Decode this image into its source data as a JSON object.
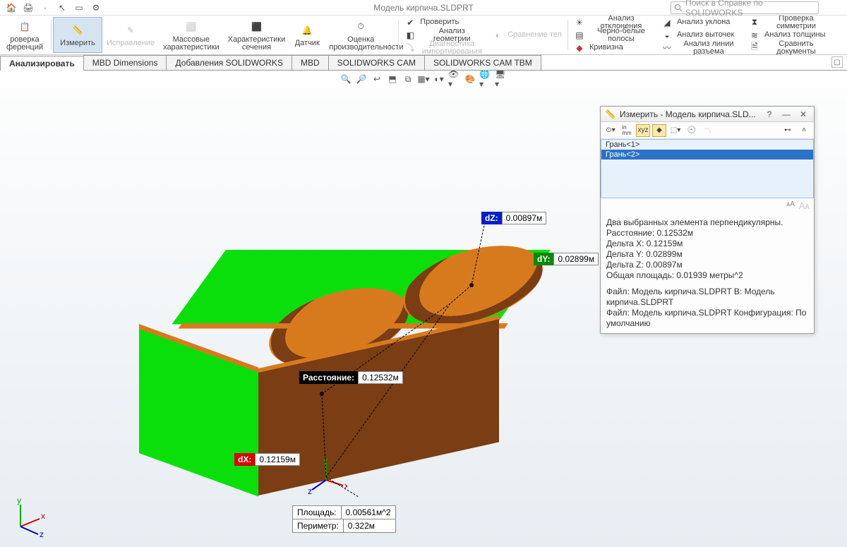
{
  "title": "Модель кирпича.SLDPRT",
  "search_placeholder": "Поиск в Справке по SOLIDWORKS",
  "ribbon": {
    "check_ref": "роверка\nференций",
    "measure": "Измерить",
    "fix": "Исправление",
    "mass": "Массовые\nхарактеристики",
    "section": "Характеристики\nсечения",
    "sensor": "Датчик",
    "perf": "Оценка\nпроизводительности",
    "check": "Проверить",
    "geom": "Анализ геометрии",
    "import": "Диагностика импортирования",
    "compare": "Сравнение тел",
    "dev": "Анализ отклонения",
    "stripes": "Черно-белые полосы",
    "curv": "Кривизна",
    "draft": "Анализ уклона",
    "undercut": "Анализ выточек",
    "parting": "Анализ линии разъема",
    "sym": "Проверка симметрии",
    "thick": "Анализ толщины",
    "diff": "Сравнить документы"
  },
  "tabs": [
    "Анализировать",
    "MBD Dimensions",
    "Добавления SOLIDWORKS",
    "MBD",
    "SOLIDWORKS CAM",
    "SOLIDWORKS CAM TBM"
  ],
  "measure": {
    "dz": {
      "k": "dZ:",
      "v": "0.00897м"
    },
    "dy": {
      "k": "dY:",
      "v": "0.02899м"
    },
    "dist": {
      "k": "Расстояние:",
      "v": "0.12532м"
    },
    "dx": {
      "k": "dX:",
      "v": "0.12159м"
    },
    "area": {
      "k": "Площадь:",
      "v": "0.00561м^2"
    },
    "perim": {
      "k": "Периметр:",
      "v": "0.322м"
    }
  },
  "dlg": {
    "title": "Измерить - Модель кирпича.SLD...",
    "units": "in\nmm",
    "sel1": "Грань<1>",
    "sel2": "Грань<2>",
    "r1": "Два выбранных элемента перпендикулярны.",
    "r2": "Расстояние: 0.12532м",
    "r3": "Дельта X: 0.12159м",
    "r4": "Дельта Y: 0.02899м",
    "r5": "Дельта Z: 0.00897м",
    "r6": "Общая площадь: 0.01939 метры^2",
    "r7": "Файл: Модель кирпича.SLDPRT В: Модель кирпича.SLDPRT",
    "r8": "Файл: Модель кирпича.SLDPRT Конфигурация: По умолчанию"
  },
  "axes": {
    "x": "x",
    "y": "y",
    "z": "z"
  }
}
